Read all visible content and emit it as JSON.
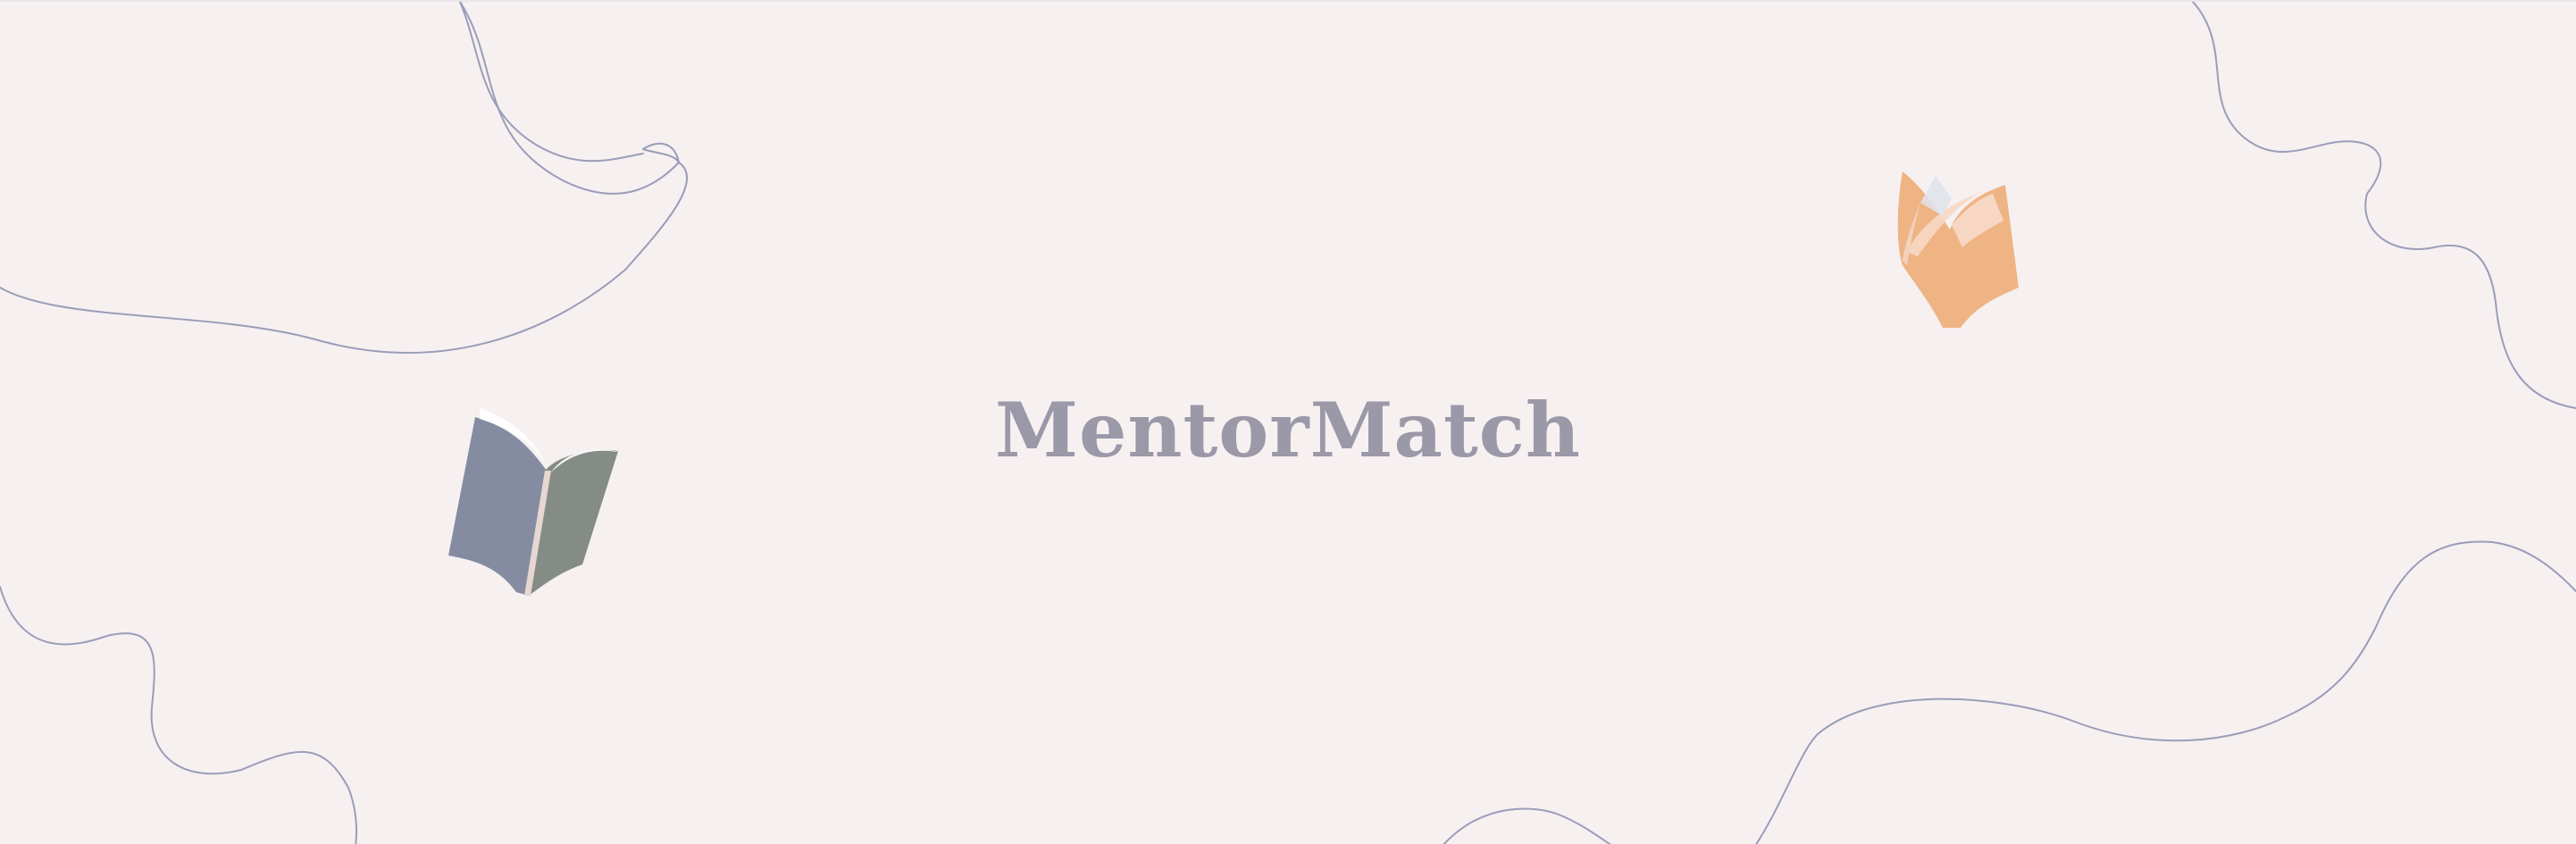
{
  "brand": {
    "title": "MentorMatch"
  },
  "icons": {
    "left": "open-book-icon",
    "right": "open-book-icon"
  },
  "colors": {
    "background": "#f6f0f1",
    "title": "#9b98a8",
    "doodle_stroke": "#9a9db9",
    "book_left_cover": "#838aa0",
    "book_left_page": "#858c86",
    "book_right_cover": "#efb483",
    "book_right_highlight": "#f7d7c3"
  }
}
